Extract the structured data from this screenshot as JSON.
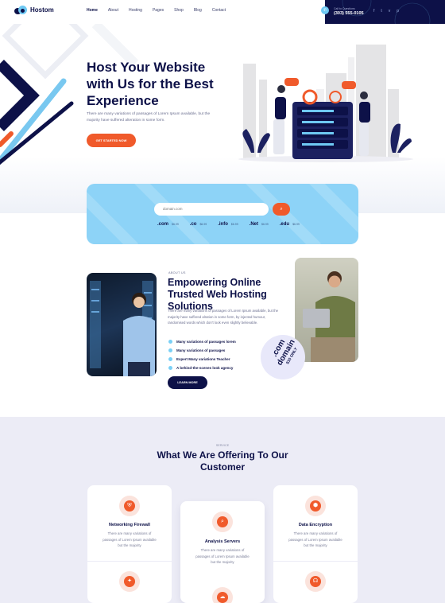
{
  "header": {
    "logo_text": "Hostom",
    "nav": [
      "Home",
      "About",
      "Hosting",
      "Pages",
      "Shop",
      "Blog",
      "Contact"
    ],
    "contact_label": "Call to Questions",
    "contact_phone": "(303) 555-0105",
    "socials": [
      "facebook-icon",
      "twitter-icon",
      "vimeo-icon",
      "pinterest-icon"
    ]
  },
  "hero": {
    "title": "Host Your Website with Us for the Best Experience",
    "description": "There are many variations of passages of Lorem Ipsum available, but the majority have suffered alteration in some form.",
    "cta": "GET STARTED NOW"
  },
  "domain_search": {
    "placeholder": "domain.com",
    "tlds": [
      {
        "name": ".com",
        "price": "$6.99"
      },
      {
        "name": ".co",
        "price": "$6.99"
      },
      {
        "name": ".info",
        "price": "$6.99"
      },
      {
        "name": ".Net",
        "price": "$6.99"
      },
      {
        "name": ".edu",
        "price": "$6.99"
      }
    ]
  },
  "about": {
    "tag": "ABOUT US",
    "title": "Empowering Online Trusted Web Hosting Solutions",
    "description": "There are many variations of passages of Lorem Ipsum available, but the majority have suffered alration in some form, by injected humour, randomised words which don't look even slightly believable.",
    "features": [
      "Many variations of passages lorem",
      "Many variations of passages",
      "Expert Many variations Teacher",
      "A behind-the-scenes look agency"
    ],
    "button": "LEARN MORE",
    "badge_line1": ".com",
    "badge_line2": "domain",
    "badge_line3": "$10 ONLY"
  },
  "services": {
    "tag": "SERVICE",
    "title": "What We Are Offering To Our Customer",
    "cards": [
      {
        "title": "Networking Firewall",
        "desc": "There are many variations of passages of Lorem Ipsum available but the majority"
      },
      {
        "title": "Analysis Servers",
        "desc": "There are many variations of passages of Lorem Ipsum available but the majority"
      },
      {
        "title": "Data Encryption",
        "desc": "There are many variations of passages of Lorem Ipsum available but the majority"
      }
    ],
    "card_icons": [
      "shield-icon",
      "server-search-icon",
      "data-lock-icon"
    ]
  },
  "colors": {
    "navy": "#0d1148",
    "accent": "#f05a2b",
    "sky": "#8dd3f7",
    "service_bg": "#ececf6"
  }
}
